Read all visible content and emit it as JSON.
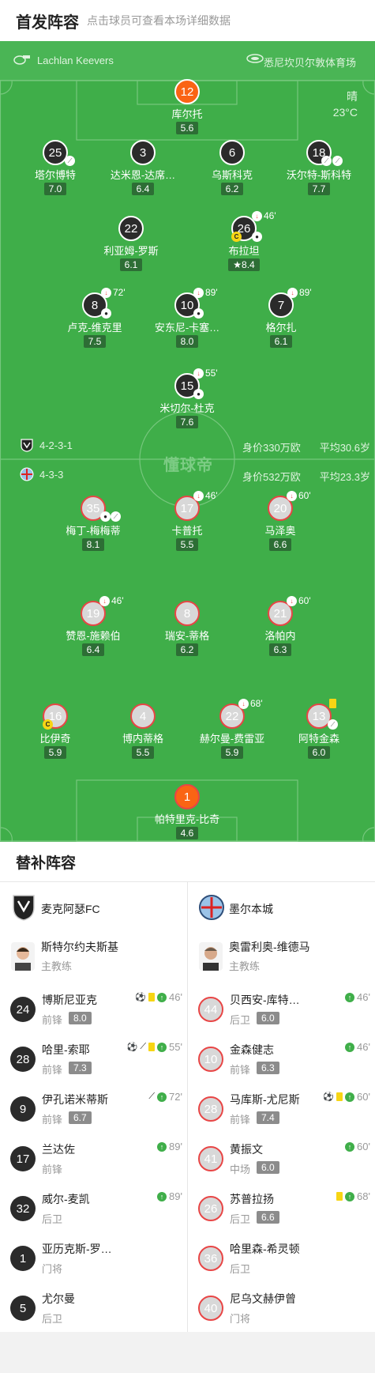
{
  "header": {
    "title": "首发阵容",
    "subtitle": "点击球员可查看本场详细数据"
  },
  "venue": {
    "coach": "Lachlan Keevers",
    "stadium": "悉尼坎贝尔敦体育场"
  },
  "weather": {
    "condition": "晴",
    "temp": "23°C"
  },
  "watermark": "懂球帝",
  "home": {
    "formation": "4-2-3-1",
    "value": "身价330万欧",
    "age": "平均30.6岁"
  },
  "away": {
    "formation": "4-3-3",
    "value": "身价532万欧",
    "age": "平均23.3岁"
  },
  "home_players": [
    {
      "num": "12",
      "name": "库尔托",
      "rating": "5.6"
    },
    {
      "num": "25",
      "name": "塔尔博特",
      "rating": "7.0"
    },
    {
      "num": "3",
      "name": "达米恩-达席…",
      "rating": "6.4"
    },
    {
      "num": "6",
      "name": "乌斯科克",
      "rating": "6.2"
    },
    {
      "num": "18",
      "name": "沃尔特-斯科特",
      "rating": "7.7"
    },
    {
      "num": "22",
      "name": "利亚姆-罗斯",
      "rating": "6.1"
    },
    {
      "num": "26",
      "name": "布拉坦",
      "rating": "8.4",
      "sub": "46'"
    },
    {
      "num": "8",
      "name": "卢克-维克里",
      "rating": "7.5",
      "sub": "72'"
    },
    {
      "num": "10",
      "name": "安东尼-卡塞…",
      "rating": "8.0",
      "sub": "89'"
    },
    {
      "num": "7",
      "name": "格尔扎",
      "rating": "6.1",
      "sub": "89'"
    },
    {
      "num": "15",
      "name": "米切尔-杜克",
      "rating": "7.6",
      "sub": "55'"
    }
  ],
  "away_players": [
    {
      "num": "35",
      "name": "梅丁-梅梅蒂",
      "rating": "8.1"
    },
    {
      "num": "17",
      "name": "卡普托",
      "rating": "5.5",
      "sub": "46'"
    },
    {
      "num": "20",
      "name": "马泽奥",
      "rating": "6.6",
      "sub": "60'"
    },
    {
      "num": "19",
      "name": "赞恩-施赖伯",
      "rating": "6.4",
      "sub": "46'"
    },
    {
      "num": "8",
      "name": "瑞安-蒂格",
      "rating": "6.2"
    },
    {
      "num": "21",
      "name": "洛帕内",
      "rating": "6.3",
      "sub": "60'"
    },
    {
      "num": "16",
      "name": "比伊奇",
      "rating": "5.9"
    },
    {
      "num": "4",
      "name": "博内蒂格",
      "rating": "5.5"
    },
    {
      "num": "22",
      "name": "赫尔曼-费雷亚",
      "rating": "5.9",
      "sub": "68'"
    },
    {
      "num": "13",
      "name": "阿特金森",
      "rating": "6.0"
    },
    {
      "num": "1",
      "name": "帕特里克-比奇",
      "rating": "4.6"
    }
  ],
  "subs": {
    "title": "替补阵容",
    "left": {
      "team": "麦克阿瑟FC",
      "coach": "斯特尔约夫斯基",
      "coach_role": "主教练",
      "players": [
        {
          "num": "24",
          "name": "博斯尼亚克",
          "pos": "前锋",
          "rating": "8.0",
          "minute": "46'"
        },
        {
          "num": "28",
          "name": "哈里-索耶",
          "pos": "前锋",
          "rating": "7.3",
          "minute": "55'"
        },
        {
          "num": "9",
          "name": "伊孔诺米蒂斯",
          "pos": "前锋",
          "rating": "6.7",
          "minute": "72'"
        },
        {
          "num": "17",
          "name": "兰达佐",
          "pos": "前锋",
          "rating": "",
          "minute": "89'"
        },
        {
          "num": "32",
          "name": "威尔-麦凯",
          "pos": "后卫",
          "rating": "",
          "minute": "89'"
        },
        {
          "num": "1",
          "name": "亚历克斯-罗…",
          "pos": "门将",
          "rating": "",
          "minute": ""
        },
        {
          "num": "5",
          "name": "尤尔曼",
          "pos": "后卫",
          "rating": "",
          "minute": ""
        }
      ]
    },
    "right": {
      "team": "墨尔本城",
      "coach": "奥雷利奥-维德马",
      "coach_role": "主教练",
      "players": [
        {
          "num": "44",
          "name": "贝西安-库特…",
          "pos": "后卫",
          "rating": "6.0",
          "minute": "46'"
        },
        {
          "num": "10",
          "name": "金森健志",
          "pos": "前锋",
          "rating": "6.3",
          "minute": "46'"
        },
        {
          "num": "28",
          "name": "马库斯-尤尼斯",
          "pos": "前锋",
          "rating": "7.4",
          "minute": "60'"
        },
        {
          "num": "41",
          "name": "黄振文",
          "pos": "中场",
          "rating": "6.0",
          "minute": "60'"
        },
        {
          "num": "26",
          "name": "苏普拉扬",
          "pos": "后卫",
          "rating": "6.6",
          "minute": "68'"
        },
        {
          "num": "36",
          "name": "哈里森-希灵顿",
          "pos": "后卫",
          "rating": "",
          "minute": ""
        },
        {
          "num": "40",
          "name": "尼乌文赫伊曾",
          "pos": "门将",
          "rating": "",
          "minute": ""
        }
      ]
    }
  },
  "colors": {
    "pitch": "#3fae49",
    "home": "#2b2b2b",
    "away_border": "#e84545",
    "gk": "#fa6414"
  }
}
